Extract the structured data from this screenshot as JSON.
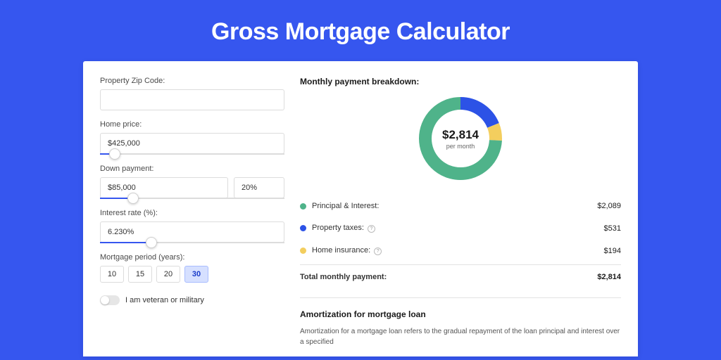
{
  "title": "Gross Mortgage Calculator",
  "form": {
    "zip_label": "Property Zip Code:",
    "zip_value": "",
    "home_price_label": "Home price:",
    "home_price_value": "$425,000",
    "home_price_slider_pct": 8,
    "down_payment_label": "Down payment:",
    "down_payment_value": "$85,000",
    "down_payment_pct_value": "20%",
    "down_payment_slider_pct": 18,
    "interest_label": "Interest rate (%):",
    "interest_value": "6.230%",
    "interest_slider_pct": 28,
    "period_label": "Mortgage period (years):",
    "period_options": [
      "10",
      "15",
      "20",
      "30"
    ],
    "period_selected": "30",
    "veteran_label": "I am veteran or military"
  },
  "breakdown": {
    "title": "Monthly payment breakdown:",
    "total_amount": "$2,814",
    "total_sub": "per month",
    "items": [
      {
        "label": "Principal & Interest:",
        "value": "$2,089",
        "color": "#4fb38a",
        "pct": 74.2,
        "info": false
      },
      {
        "label": "Property taxes:",
        "value": "$531",
        "color": "#2c52e6",
        "pct": 18.9,
        "info": true
      },
      {
        "label": "Home insurance:",
        "value": "$194",
        "color": "#f3ce5e",
        "pct": 6.9,
        "info": true
      }
    ],
    "total_label": "Total monthly payment:",
    "total_value": "$2,814"
  },
  "amortization": {
    "title": "Amortization for mortgage loan",
    "text": "Amortization for a mortgage loan refers to the gradual repayment of the loan principal and interest over a specified"
  },
  "chart_data": {
    "type": "pie",
    "title": "Monthly payment breakdown",
    "categories": [
      "Principal & Interest",
      "Property taxes",
      "Home insurance"
    ],
    "values": [
      2089,
      531,
      194
    ],
    "total": 2814,
    "colors": [
      "#4fb38a",
      "#2c52e6",
      "#f3ce5e"
    ]
  }
}
